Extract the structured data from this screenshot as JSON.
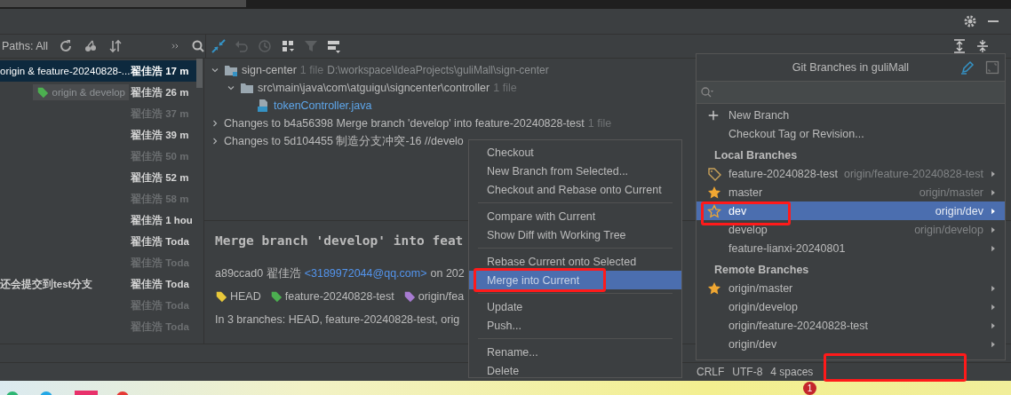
{
  "log_toolbar": {
    "paths_filter": "Paths: All"
  },
  "commits": [
    {
      "subject": "origin & feature-20240828-...",
      "author": "翟佳浩",
      "time": "17 m",
      "selected": true,
      "dimmed": false
    },
    {
      "tag": "origin & develop",
      "author": "翟佳浩",
      "time": "26 m",
      "selected": false,
      "dimmed": false
    },
    {
      "author": "翟佳浩",
      "time": "37 m",
      "selected": false,
      "dimmed": true
    },
    {
      "author": "翟佳浩",
      "time": "39 m",
      "selected": false,
      "dimmed": false
    },
    {
      "author": "翟佳浩",
      "time": "50 m",
      "selected": false,
      "dimmed": true
    },
    {
      "author": "翟佳浩",
      "time": "52 m",
      "selected": false,
      "dimmed": false
    },
    {
      "author": "翟佳浩",
      "time": "58 m",
      "selected": false,
      "dimmed": true
    },
    {
      "author": "翟佳浩",
      "time": "1 hou",
      "selected": false,
      "dimmed": false
    },
    {
      "author": "翟佳浩",
      "time": "Toda",
      "selected": false,
      "dimmed": false
    },
    {
      "author": "翟佳浩",
      "time": "Toda",
      "selected": false,
      "dimmed": true
    },
    {
      "subject": "还会提交到test分支",
      "author": "翟佳浩",
      "time": "Toda",
      "selected": false,
      "dimmed": false
    },
    {
      "author": "翟佳浩",
      "time": "Toda",
      "selected": false,
      "dimmed": true
    },
    {
      "author": "翟佳浩",
      "time": "Toda",
      "selected": false,
      "dimmed": true
    }
  ],
  "changes_tree": [
    {
      "kind": "module",
      "label": "sign-center",
      "count": "1 file",
      "path": "D:\\workspace\\IdeaProjects\\guliMall\\sign-center",
      "expanded": true,
      "children": [
        {
          "kind": "folder",
          "label": "src\\main\\java\\com\\atguigu\\signcenter\\controller",
          "count": "1 file",
          "expanded": true,
          "children": [
            {
              "kind": "java_file",
              "label": "tokenController.java"
            }
          ]
        }
      ]
    },
    {
      "kind": "group",
      "label": "Changes to b4a56398 Merge branch 'develop' into feature-20240828-test",
      "count": "1 file",
      "expanded": false
    },
    {
      "kind": "group",
      "label": "Changes to 5d104455 制造分支冲突-16 //develo",
      "expanded": false
    }
  ],
  "commit_details": {
    "title": "Merge branch 'develop' into feat",
    "hash_author": "a89ccad0 翟佳浩",
    "email": "<3189972044@qq.com>",
    "date": "on 202",
    "refs": [
      {
        "label": "HEAD",
        "color": "#e8c83a"
      },
      {
        "label": "feature-20240828-test",
        "color": "#4caf50"
      },
      {
        "label": "origin/fea",
        "color": "#a77bd1"
      }
    ],
    "branches": "In 3 branches: HEAD, feature-20240828-test, orig"
  },
  "context_menu": [
    [
      {
        "label": "Checkout",
        "selected": false
      },
      {
        "label": "New Branch from Selected...",
        "selected": false
      },
      {
        "label": "Checkout and Rebase onto Current",
        "selected": false
      }
    ],
    [
      {
        "label": "Compare with Current",
        "selected": false
      },
      {
        "label": "Show Diff with Working Tree",
        "selected": false
      }
    ],
    [
      {
        "label": "Rebase Current onto Selected",
        "selected": false
      },
      {
        "label": "Merge into Current",
        "selected": true
      }
    ],
    [
      {
        "label": "Update",
        "selected": false
      },
      {
        "label": "Push...",
        "selected": false
      }
    ],
    [
      {
        "label": "Rename...",
        "selected": false
      },
      {
        "label": "Delete",
        "selected": false
      }
    ]
  ],
  "branches_popup": {
    "title": "Git Branches in guliMall",
    "actions": [
      {
        "label": "New Branch",
        "kind": "plus"
      },
      {
        "label": "Checkout Tag or Revision..."
      }
    ],
    "sections": [
      {
        "heading": "Local Branches",
        "items": [
          {
            "name": "feature-20240828-test",
            "tracking": "origin/feature-20240828-test",
            "kind": "tag",
            "selected": false
          },
          {
            "name": "master",
            "tracking": "origin/master",
            "kind": "star",
            "selected": false
          },
          {
            "name": "dev",
            "tracking": "origin/dev",
            "kind": "star_outline",
            "selected": true
          },
          {
            "name": "develop",
            "tracking": "origin/develop",
            "selected": false
          },
          {
            "name": "feature-lianxi-20240801",
            "selected": false
          }
        ]
      },
      {
        "heading": "Remote Branches",
        "items": [
          {
            "name": "origin/master",
            "kind": "star",
            "selected": false
          },
          {
            "name": "origin/develop",
            "selected": false
          },
          {
            "name": "origin/feature-20240828-test",
            "selected": false
          },
          {
            "name": "origin/dev",
            "selected": false
          }
        ]
      }
    ]
  },
  "status_bar": [
    "CRLF",
    "UTF-8",
    "4 spaces"
  ],
  "taskbar": {
    "badge": "1"
  }
}
